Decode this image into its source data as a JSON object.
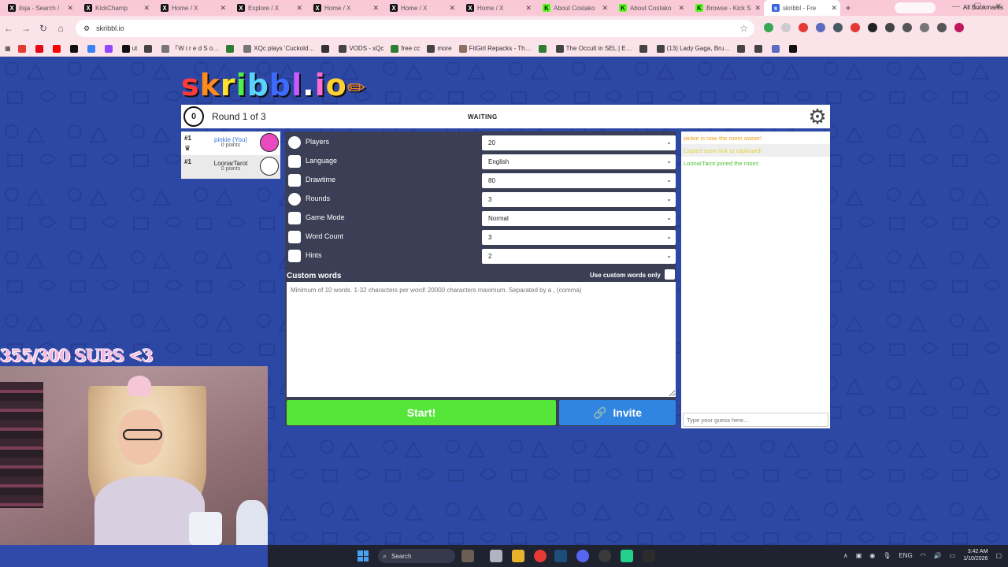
{
  "tabs": [
    {
      "label": "itsja - Search /",
      "fav": "x"
    },
    {
      "label": "KickChamp",
      "fav": "x"
    },
    {
      "label": "Home / X",
      "fav": "x"
    },
    {
      "label": "Explore / X",
      "fav": "x"
    },
    {
      "label": "Home / X",
      "fav": "x"
    },
    {
      "label": "Home / X",
      "fav": "x"
    },
    {
      "label": "Home / X",
      "fav": "x"
    },
    {
      "label": "About Costako",
      "fav": "kick"
    },
    {
      "label": "About Costako",
      "fav": "kick"
    },
    {
      "label": "Browse - Kick S",
      "fav": "kick"
    },
    {
      "label": "skribbl - Fre",
      "fav": "skrib",
      "active": true
    }
  ],
  "browser": {
    "new_tab": "+",
    "url": "skribbl.io",
    "nav": {
      "back": "←",
      "forward": "→",
      "reload": "↻",
      "home": "⌂"
    }
  },
  "bookmarks": [
    {
      "label": "",
      "color": "#e53935"
    },
    {
      "label": "",
      "color": "#e50914"
    },
    {
      "label": "",
      "color": "#ff0000"
    },
    {
      "label": "",
      "color": "#111111"
    },
    {
      "label": "",
      "color": "#3b82f6"
    },
    {
      "label": "",
      "color": "#9146ff"
    },
    {
      "label": "ut",
      "color": "#111111"
    },
    {
      "label": "",
      "color": "#444444"
    },
    {
      "label": "「W i r e d   S o…",
      "color": "#777777"
    },
    {
      "label": "",
      "color": "#2e7d32"
    },
    {
      "label": "XQc plays 'Cuckold…",
      "color": "#777777"
    },
    {
      "label": "",
      "color": "#333333"
    },
    {
      "label": "VODS - xQc",
      "color": "#444444"
    },
    {
      "label": "free cc",
      "color": "#2e7d32"
    },
    {
      "label": "more",
      "color": "#444444"
    },
    {
      "label": "FitGirl Repacks - Th…",
      "color": "#8d6e63"
    },
    {
      "label": "",
      "color": "#2e7d32"
    },
    {
      "label": "The Occult in SEL | E…",
      "color": "#444444"
    },
    {
      "label": "",
      "color": "#444444"
    },
    {
      "label": "(13) Lady Gaga, Bru…",
      "color": "#444444"
    },
    {
      "label": "",
      "color": "#444444"
    },
    {
      "label": "",
      "color": "#444444"
    },
    {
      "label": "",
      "color": "#5c6bc0"
    },
    {
      "label": "",
      "color": "#111111"
    }
  ],
  "all_bookmarks": "All Bookmarks",
  "logo": {
    "letters": [
      "s",
      "k",
      "r",
      "i",
      "b",
      "b",
      "l",
      ".",
      "i",
      "o"
    ],
    "colors": [
      "#ff3b3b",
      "#ff8a1e",
      "#ffe32b",
      "#4df04d",
      "#5ad4ff",
      "#3e6bff",
      "#c45aff",
      "#ffffff",
      "#ff6bd5",
      "#ffd230"
    ],
    "pencil": "✏"
  },
  "game": {
    "timer": "0",
    "round_label": "Round 1 of 3",
    "status": "WAITING",
    "settings_icon": "⚙"
  },
  "players": [
    {
      "rank": "#1",
      "name": "pinkie (You)",
      "points": "0 points",
      "avatar_color": "#e94bbf",
      "owner": true
    },
    {
      "rank": "#1",
      "name": "LoonarTarot",
      "points": "0 points",
      "avatar_color": "#ffffff",
      "owner": false
    }
  ],
  "settings": [
    {
      "label": "Players",
      "value": "20"
    },
    {
      "label": "Language",
      "value": "English"
    },
    {
      "label": "Drawtime",
      "value": "80"
    },
    {
      "label": "Rounds",
      "value": "3"
    },
    {
      "label": "Game Mode",
      "value": "Normal"
    },
    {
      "label": "Word Count",
      "value": "3"
    },
    {
      "label": "Hints",
      "value": "2"
    }
  ],
  "custom_words": {
    "title": "Custom words",
    "checkbox_label": "Use custom words only",
    "placeholder": "Minimum of 10 words. 1-32 characters per word! 20000 characters maximum. Separated by a , (comma)"
  },
  "buttons": {
    "start": "Start!",
    "invite": "Invite",
    "invite_icon": "🔗"
  },
  "chat": {
    "messages": [
      {
        "text": "pinkie is now the room owner!",
        "kind": "orange"
      },
      {
        "text": "Copied room link to clipboard!",
        "kind": "yellow"
      },
      {
        "text": "LoonarTarot joined the room!",
        "kind": "green"
      }
    ],
    "input_placeholder": "Type your guess here..."
  },
  "overlay": {
    "sub_counter": "355/300 SUBS <3"
  },
  "taskbar": {
    "search": "Search",
    "lang": "ENG",
    "time": "3:42 AM",
    "date": "1/10/2026"
  }
}
